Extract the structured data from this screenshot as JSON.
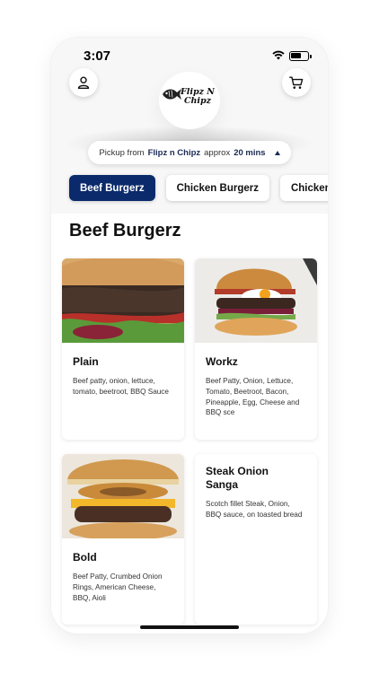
{
  "status": {
    "time": "3:07"
  },
  "header": {
    "logo_line1": "Flipz N",
    "logo_line2": "Chipz",
    "pickup_prefix": "Pickup from",
    "pickup_store": "Flipz n Chipz",
    "pickup_mid": "approx",
    "pickup_time": "20 mins"
  },
  "tabs": [
    {
      "label": "Beef Burgerz",
      "active": true
    },
    {
      "label": "Chicken Burgerz",
      "active": false
    },
    {
      "label": "Chicken",
      "active": false
    }
  ],
  "section": {
    "title": "Beef Burgerz"
  },
  "items": [
    {
      "name": "Plain",
      "description": "Beef patty, onion, lettuce, tomato, beetroot, BBQ Sauce"
    },
    {
      "name": "Workz",
      "description": "Beef Patty, Onion, Lettuce, Tomato, Beetroot, Bacon, Pineapple, Egg, Cheese and BBQ sce"
    },
    {
      "name": "Bold",
      "description": "Beef Patty, Crumbed Onion Rings, American Cheese, BBQ, Aioli"
    },
    {
      "name": "Steak Onion Sanga",
      "description": "Scotch fillet Steak, Onion, BBQ sauce, on toasted bread"
    }
  ],
  "colors": {
    "accent": "#0b2a6b",
    "background": "#f7f7f7",
    "card": "#ffffff"
  },
  "icons": {
    "profile": "user-icon",
    "cart": "cart-icon",
    "wifi": "wifi-icon",
    "battery": "battery-icon"
  }
}
